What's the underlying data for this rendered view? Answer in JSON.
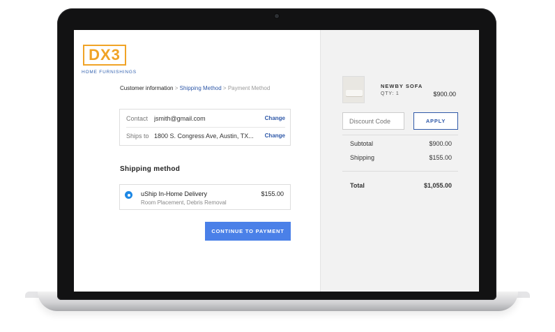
{
  "brand": {
    "logo_text": "DX3",
    "tagline": "HOME FURNISHINGS",
    "accent_color": "#f0a326",
    "link_color": "#2e58a8"
  },
  "breadcrumb": {
    "step1": "Customer information",
    "sep1": ">",
    "step2": "Shipping Method",
    "sep2": ">",
    "step3": "Payment Method"
  },
  "contact": {
    "label": "Contact",
    "value": "jsmith@gmail.com",
    "change": "Change"
  },
  "ships_to": {
    "label": "Ships to",
    "value": "1800 S. Congress Ave, Austin, TX...",
    "change": "Change"
  },
  "shipping": {
    "title": "Shipping method",
    "option_name": "uShip In-Home Delivery",
    "option_desc": "Room Placement, Debris Removal",
    "option_price": "$155.00",
    "selected": true
  },
  "continue_button": "CONTINUE TO PAYMENT",
  "cart": {
    "product_name": "NEWBY SOFA",
    "product_qty": "QTY: 1",
    "product_price": "$900.00"
  },
  "discount": {
    "placeholder": "Discount Code",
    "apply_label": "APPLY"
  },
  "summary": {
    "subtotal_label": "Subtotal",
    "subtotal_value": "$900.00",
    "shipping_label": "Shipping",
    "shipping_value": "$155.00",
    "total_label": "Total",
    "total_value": "$1,055.00"
  }
}
